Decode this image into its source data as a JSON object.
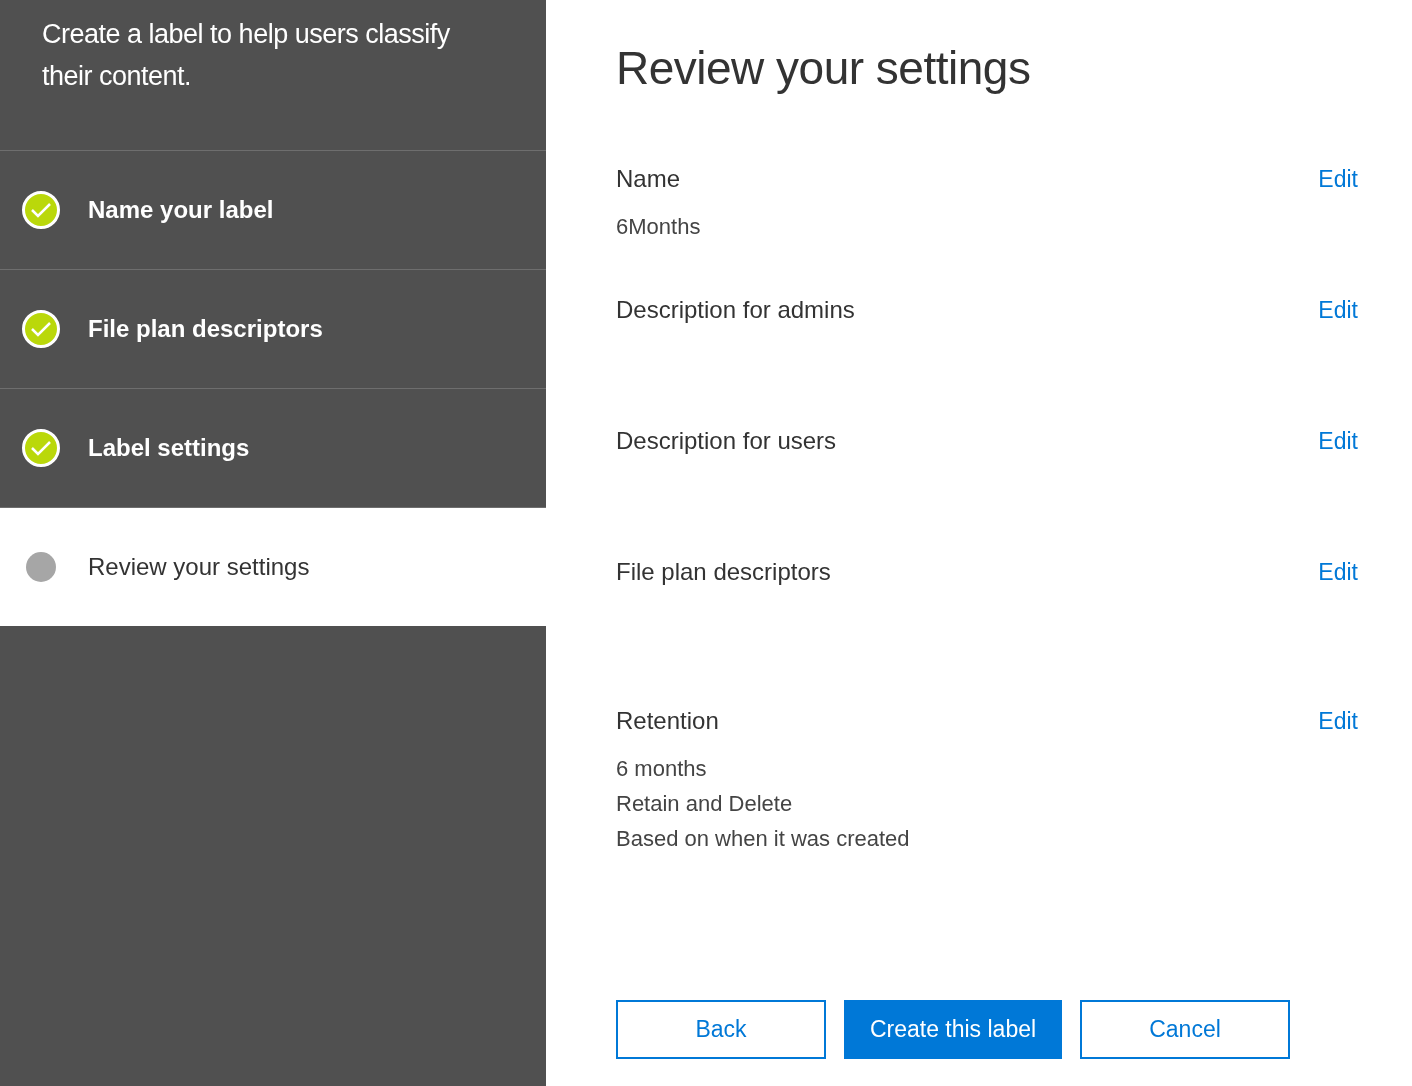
{
  "sidebar": {
    "intro": "Create a label to help users classify their content.",
    "steps": [
      {
        "label": "Name your label",
        "completed": true,
        "selected": false
      },
      {
        "label": "File plan descriptors",
        "completed": true,
        "selected": false
      },
      {
        "label": "Label settings",
        "completed": true,
        "selected": false
      },
      {
        "label": "Review your settings",
        "completed": false,
        "selected": true
      }
    ]
  },
  "main": {
    "title": "Review your settings",
    "sections": [
      {
        "heading": "Name",
        "edit": "Edit",
        "values": [
          "6Months"
        ]
      },
      {
        "heading": "Description for admins",
        "edit": "Edit"
      },
      {
        "heading": "Description for users",
        "edit": "Edit"
      },
      {
        "heading": "File plan descriptors",
        "edit": "Edit"
      },
      {
        "heading": "Retention",
        "edit": "Edit",
        "values": [
          "6 months",
          "Retain and Delete",
          "Based on when it was created"
        ]
      }
    ],
    "buttons": [
      {
        "label": "Back",
        "kind": "secondary"
      },
      {
        "label": "Create this label",
        "kind": "primary"
      },
      {
        "label": "Cancel",
        "kind": "secondary"
      }
    ]
  }
}
